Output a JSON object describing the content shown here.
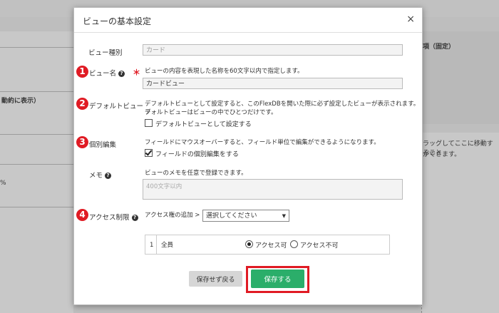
{
  "modal": {
    "title": "ビューの基本設定",
    "close": "×"
  },
  "background": {
    "left_text": "動約に表示）",
    "left_pct": "%",
    "right_header": "項（固定）",
    "right_text_1": "ラッグしてここに移動すること",
    "right_text_2": "ができます。"
  },
  "fields": {
    "view_type": {
      "label": "ビュー種別",
      "value": "カード"
    },
    "view_name": {
      "label": "ビュー名",
      "required_mark": "＊",
      "description": "ビューの内容を表現した名称を60文字以内で指定します。",
      "value": "カードビュー"
    },
    "default_view": {
      "label": "デフォルトビュー",
      "description_1": "デフォルトビューとして設定すると、このFlexDBを開いた際に必ず設定したビューが表示されます。デ",
      "description_2": "フォルトビューはビューの中でひとつだけです。",
      "checkbox_label": "デフォルトビューとして設定する",
      "checked": false
    },
    "individual_edit": {
      "label": "個別編集",
      "description": "フィールドにマウスオーバーすると、フィールド単位で編集ができるようになります。",
      "checkbox_label": "フィールドの個別編集をする",
      "checked": true
    },
    "memo": {
      "label": "メモ",
      "description": "ビューのメモを任意で登録できます。",
      "placeholder": "400文字以内"
    },
    "access": {
      "label": "アクセス制限",
      "add_label": "アクセス権の追加 >",
      "select_value": "選択してください",
      "rows": [
        {
          "index": "1",
          "name": "全員",
          "option_allow": "アクセス可",
          "option_deny": "アクセス不可",
          "selected": "allow"
        }
      ]
    }
  },
  "markers": [
    "1",
    "2",
    "3",
    "4"
  ],
  "buttons": {
    "cancel": "保存せず戻る",
    "save": "保存する"
  },
  "colors": {
    "accent_red": "#e01b24",
    "save_green": "#2bae6a"
  }
}
